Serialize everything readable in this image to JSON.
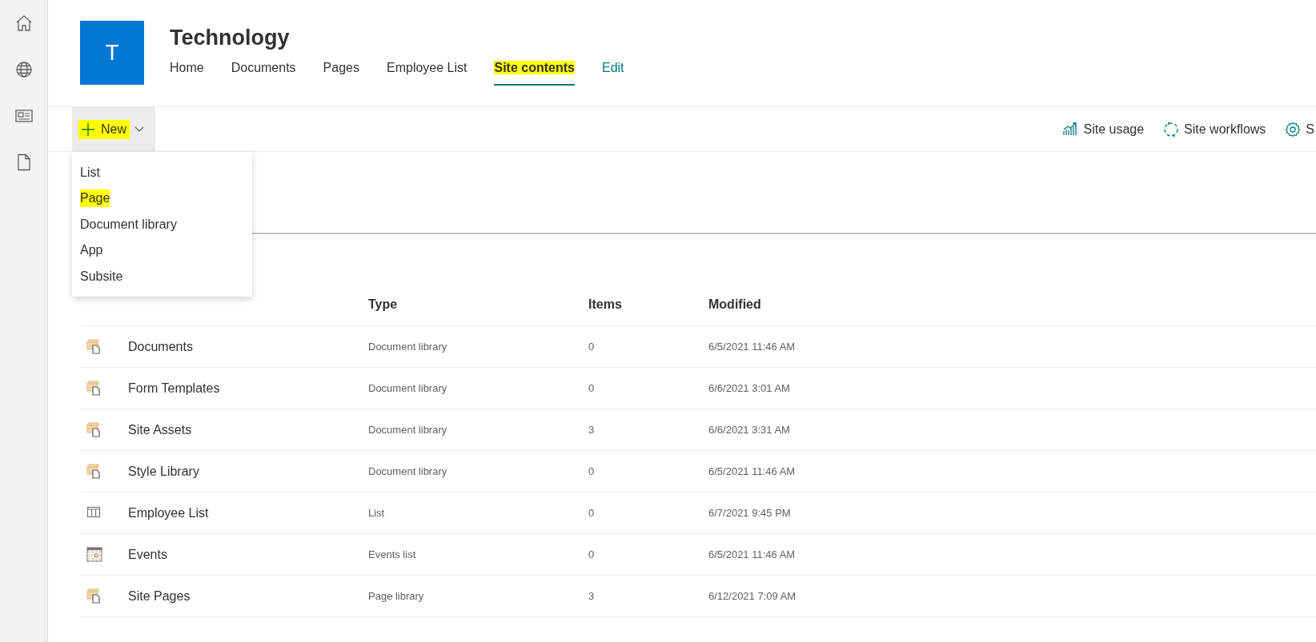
{
  "rail": [
    {
      "kind": "home"
    },
    {
      "kind": "globe"
    },
    {
      "kind": "news"
    },
    {
      "kind": "document"
    }
  ],
  "site": {
    "logo_letter": "T",
    "title": "Technology"
  },
  "nav": [
    {
      "label": "Home",
      "selected": false,
      "highlighted": false,
      "kind": "page"
    },
    {
      "label": "Documents",
      "selected": false,
      "highlighted": false,
      "kind": "page"
    },
    {
      "label": "Pages",
      "selected": false,
      "highlighted": false,
      "kind": "page"
    },
    {
      "label": "Employee List",
      "selected": false,
      "highlighted": false,
      "kind": "page"
    },
    {
      "label": "Site contents",
      "selected": true,
      "highlighted": true,
      "kind": "page"
    },
    {
      "label": "Edit",
      "selected": false,
      "highlighted": false,
      "kind": "action"
    }
  ],
  "toolbar": {
    "new_button": {
      "label": "New",
      "highlighted": true,
      "expanded": true
    },
    "actions": [
      {
        "kind": "usage",
        "label": "Site usage"
      },
      {
        "kind": "workflows",
        "label": "Site workflows"
      },
      {
        "kind": "settings",
        "label": "S"
      }
    ]
  },
  "new_menu": [
    {
      "label": "List",
      "highlighted": false
    },
    {
      "label": "Page",
      "highlighted": true
    },
    {
      "label": "Document library",
      "highlighted": false
    },
    {
      "label": "App",
      "highlighted": false
    },
    {
      "label": "Subsite",
      "highlighted": false
    }
  ],
  "table": {
    "columns": [
      "Type",
      "Items",
      "Modified"
    ],
    "rows": [
      {
        "kind": "library",
        "name": "Documents",
        "type": "Document library",
        "items": "0",
        "modified": "6/5/2021 11:46 AM"
      },
      {
        "kind": "library",
        "name": "Form Templates",
        "type": "Document library",
        "items": "0",
        "modified": "6/6/2021 3:01 AM"
      },
      {
        "kind": "library",
        "name": "Site Assets",
        "type": "Document library",
        "items": "3",
        "modified": "6/6/2021 3:31 AM"
      },
      {
        "kind": "library",
        "name": "Style Library",
        "type": "Document library",
        "items": "0",
        "modified": "6/5/2021 11:46 AM"
      },
      {
        "kind": "list",
        "name": "Employee List",
        "type": "List",
        "items": "0",
        "modified": "6/7/2021 9:45 PM"
      },
      {
        "kind": "events",
        "name": "Events",
        "type": "Events list",
        "items": "0",
        "modified": "6/5/2021 11:46 AM"
      },
      {
        "kind": "library",
        "name": "Site Pages",
        "type": "Page library",
        "items": "3",
        "modified": "6/12/2021 7:09 AM"
      }
    ]
  }
}
